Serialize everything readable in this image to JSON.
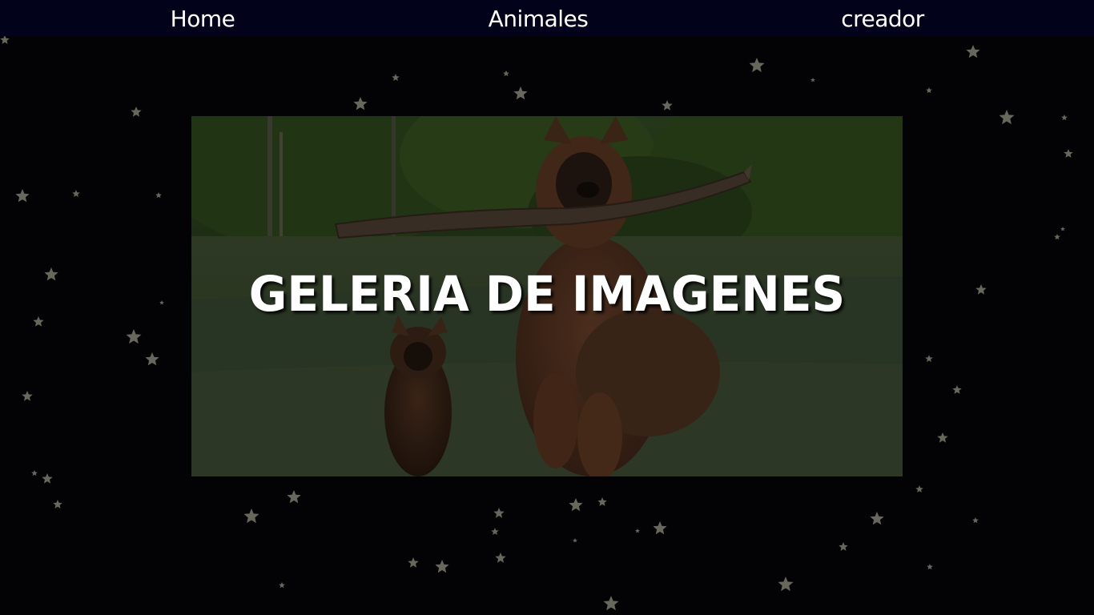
{
  "nav": {
    "home": "Home",
    "animales": "Animales",
    "creador": "creador"
  },
  "hero": {
    "title": "GELERIA DE IMAGENES",
    "image_description_icon": "dog-photo"
  },
  "colors": {
    "page_background": "#030306",
    "navbar_background": "#02031a",
    "nav_text": "#ffffff",
    "star": "#8a8a7a"
  }
}
